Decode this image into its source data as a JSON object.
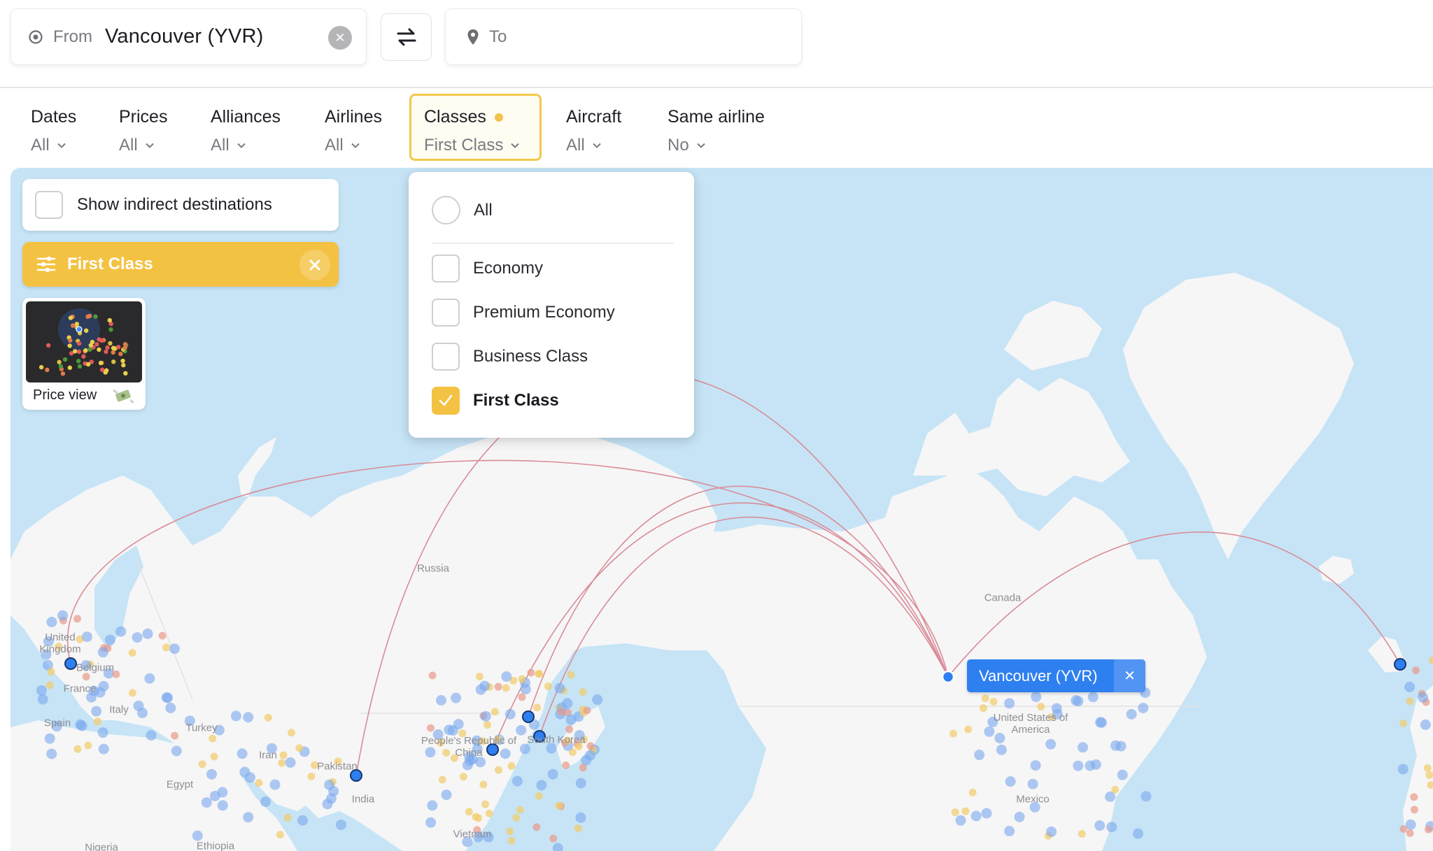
{
  "search": {
    "from_label": "From",
    "from_value": "Vancouver (YVR)",
    "from_clear_icon": "close-icon",
    "swap_icon": "swap-arrows-icon",
    "to_placeholder": "To",
    "to_icon": "map-pin-icon",
    "from_icon": "target-circle-icon"
  },
  "filters": [
    {
      "title": "Dates",
      "value": "All",
      "active": false
    },
    {
      "title": "Prices",
      "value": "All",
      "active": false
    },
    {
      "title": "Alliances",
      "value": "All",
      "active": false
    },
    {
      "title": "Airlines",
      "value": "All",
      "active": false
    },
    {
      "title": "Classes",
      "value": "First Class",
      "active": true
    },
    {
      "title": "Aircraft",
      "value": "All",
      "active": false
    },
    {
      "title": "Same airline",
      "value": "No",
      "active": false
    }
  ],
  "classes_dropdown": {
    "options": [
      {
        "label": "All",
        "type": "radio",
        "checked": false
      },
      {
        "label": "Economy",
        "type": "checkbox",
        "checked": false
      },
      {
        "label": "Premium Economy",
        "type": "checkbox",
        "checked": false
      },
      {
        "label": "Business Class",
        "type": "checkbox",
        "checked": false
      },
      {
        "label": "First Class",
        "type": "checkbox",
        "checked": true
      }
    ]
  },
  "map_panel": {
    "indirect_label": "Show indirect destinations",
    "indirect_checked": false,
    "active_filter_chip": "First Class",
    "price_view_label": "Price view"
  },
  "map": {
    "origin": {
      "name": "Vancouver (YVR)",
      "lat": 49.19,
      "lon": -123.18
    },
    "destinations": [
      {
        "name": "London",
        "lat": 51.47,
        "lon": -0.45,
        "copy": "west"
      },
      {
        "name": "London",
        "lat": 51.47,
        "lon": -0.45,
        "copy": "east"
      },
      {
        "name": "Delhi",
        "lat": 28.56,
        "lon": 77.1
      },
      {
        "name": "Beijing",
        "lat": 40.08,
        "lon": 116.58
      },
      {
        "name": "Shanghai",
        "lat": 31.14,
        "lon": 121.8
      },
      {
        "name": "Seoul",
        "lat": 37.46,
        "lon": 126.44
      }
    ],
    "country_labels": [
      "Russia",
      "Canada",
      "United States of America",
      "Mexico",
      "United Kingdom",
      "Belgium",
      "France",
      "Italy",
      "Spain",
      "Turkey",
      "Iran",
      "Egypt",
      "Pakistan",
      "India",
      "People's Republic of China",
      "South Korea",
      "Vietnam",
      "Nigeria",
      "Ethiopia"
    ],
    "colors": {
      "water": "#c6e4f6",
      "land": "#f6f6f6",
      "route": "#d98c98",
      "dest_dot": "#2e7ff0",
      "other_blue": "#7aa8ee",
      "other_yellow": "#f2cc6a",
      "other_red": "#ea9a8a"
    }
  },
  "colors": {
    "accent_yellow": "#f4c242",
    "accent_blue": "#2e7ff0"
  }
}
